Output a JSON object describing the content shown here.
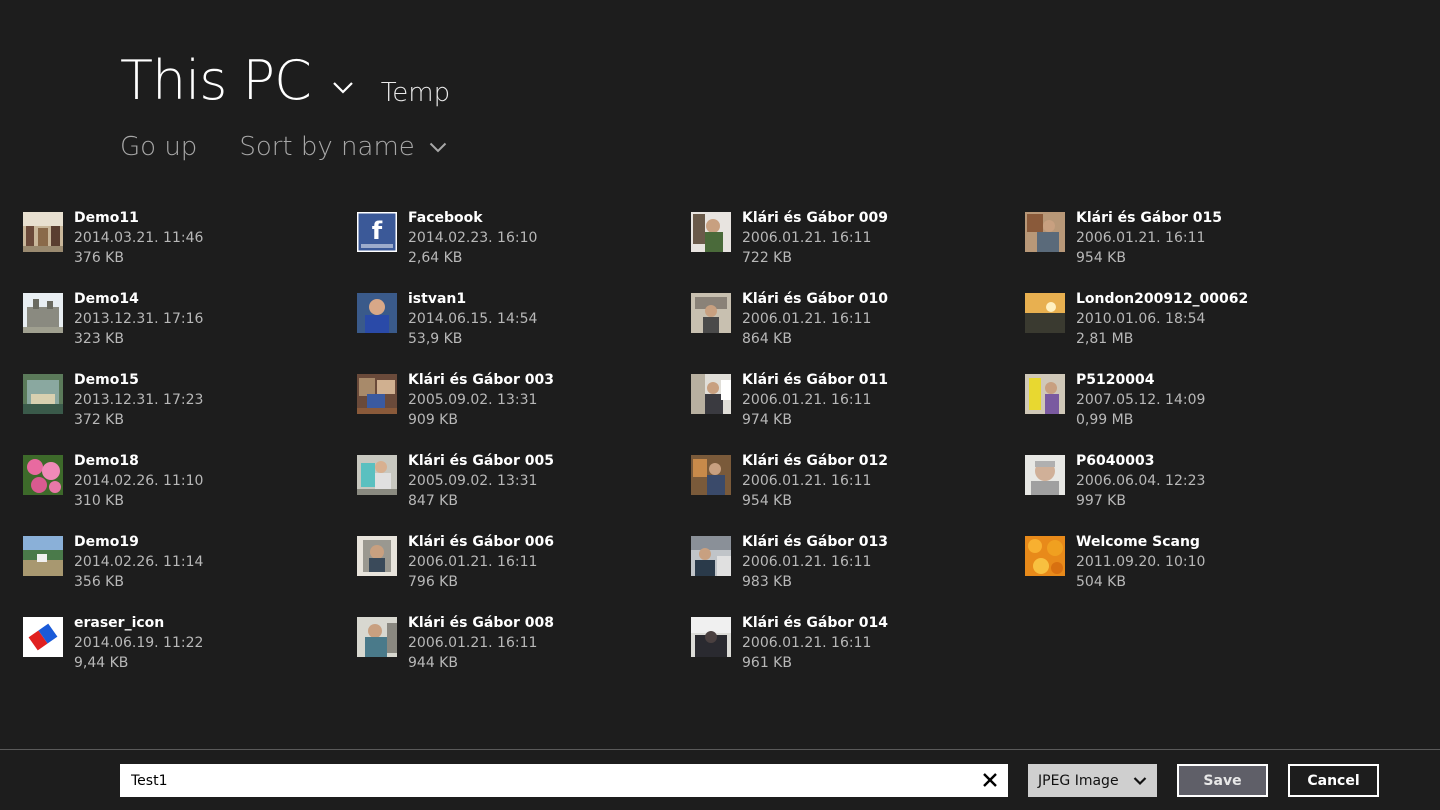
{
  "header": {
    "location": "This PC",
    "subfolder": "Temp"
  },
  "toolbar": {
    "go_up": "Go up",
    "sort": "Sort by name"
  },
  "files": [
    {
      "name": "Demo11",
      "date": "2014.03.21. 11:46",
      "size": "376 KB"
    },
    {
      "name": "Demo14",
      "date": "2013.12.31. 17:16",
      "size": "323 KB"
    },
    {
      "name": "Demo15",
      "date": "2013.12.31. 17:23",
      "size": "372 KB"
    },
    {
      "name": "Demo18",
      "date": "2014.02.26. 11:10",
      "size": "310 KB"
    },
    {
      "name": "Demo19",
      "date": "2014.02.26. 11:14",
      "size": "356 KB"
    },
    {
      "name": "eraser_icon",
      "date": "2014.06.19. 11:22",
      "size": "9,44 KB"
    },
    {
      "name": "Facebook",
      "date": "2014.02.23. 16:10",
      "size": "2,64 KB"
    },
    {
      "name": "istvan1",
      "date": "2014.06.15. 14:54",
      "size": "53,9 KB"
    },
    {
      "name": "Klári és Gábor 003",
      "date": "2005.09.02. 13:31",
      "size": "909 KB"
    },
    {
      "name": "Klári és Gábor 005",
      "date": "2005.09.02. 13:31",
      "size": "847 KB"
    },
    {
      "name": "Klári és Gábor 006",
      "date": "2006.01.21. 16:11",
      "size": "796 KB"
    },
    {
      "name": "Klári és Gábor 008",
      "date": "2006.01.21. 16:11",
      "size": "944 KB"
    },
    {
      "name": "Klári és Gábor 009",
      "date": "2006.01.21. 16:11",
      "size": "722 KB"
    },
    {
      "name": "Klári és Gábor 010",
      "date": "2006.01.21. 16:11",
      "size": "864 KB"
    },
    {
      "name": "Klári és Gábor 011",
      "date": "2006.01.21. 16:11",
      "size": "974 KB"
    },
    {
      "name": "Klári és Gábor 012",
      "date": "2006.01.21. 16:11",
      "size": "954 KB"
    },
    {
      "name": "Klári és Gábor 013",
      "date": "2006.01.21. 16:11",
      "size": "983 KB"
    },
    {
      "name": "Klári és Gábor 014",
      "date": "2006.01.21. 16:11",
      "size": "961 KB"
    },
    {
      "name": "Klári és Gábor 015",
      "date": "2006.01.21. 16:11",
      "size": "954 KB"
    },
    {
      "name": "London200912_00062",
      "date": "2010.01.06. 18:54",
      "size": "2,81 MB"
    },
    {
      "name": "P5120004",
      "date": "2007.05.12. 14:09",
      "size": "0,99 MB"
    },
    {
      "name": "P6040003",
      "date": "2006.06.04. 12:23",
      "size": "997 KB"
    },
    {
      "name": "Welcome Scang",
      "date": "2011.09.20. 10:10",
      "size": "504 KB"
    }
  ],
  "bottom": {
    "filename_value": "Test1",
    "file_type": "JPEG Image",
    "save_label": "Save",
    "cancel_label": "Cancel"
  },
  "colors": {
    "background": "#1d1d1d",
    "secondary_text": "#b8b8b8",
    "save_button_bg": "#5f5f68"
  },
  "icons": {
    "location_dropdown": "chevron-down-icon",
    "sort_dropdown": "chevron-down-icon",
    "clear": "close-icon",
    "type_dropdown": "chevron-down-icon"
  }
}
